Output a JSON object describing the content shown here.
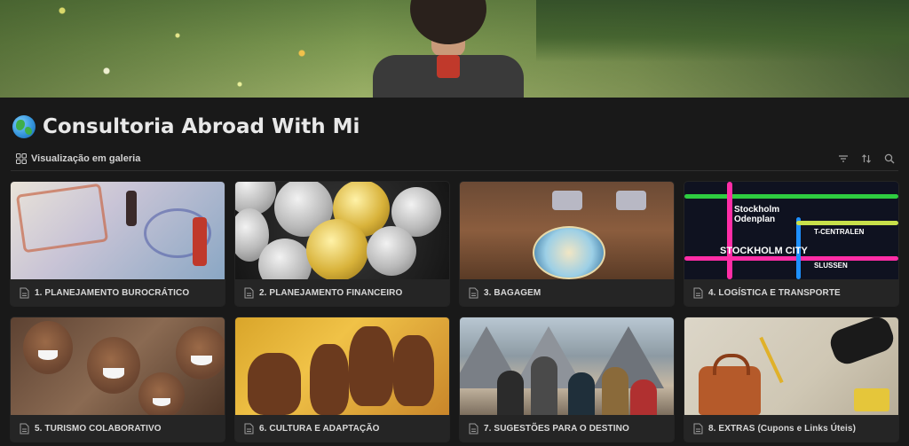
{
  "page": {
    "title": "Consultoria Abroad With Mi",
    "icon": "globe-icon"
  },
  "view": {
    "label": "Visualização em galeria",
    "icon": "gallery-grid-icon",
    "tools": [
      "filter-icon",
      "sort-icon",
      "search-icon"
    ]
  },
  "gallery": {
    "cards": [
      {
        "title": "1. PLANEJAMENTO BUROCRÁTICO"
      },
      {
        "title": "2. PLANEJAMENTO FINANCEIRO"
      },
      {
        "title": "3. BAGAGEM"
      },
      {
        "title": "4. LOGÍSTICA E TRANSPORTE"
      },
      {
        "title": "5. TURISMO COLABORATIVO"
      },
      {
        "title": "6. CULTURA E ADAPTAÇÃO"
      },
      {
        "title": "7. SUGESTÕES PARA O DESTINO"
      },
      {
        "title": "8. EXTRAS (Cupons e Links Úteis)"
      }
    ]
  },
  "thumbnails": {
    "metro_map": {
      "station_top": "Stockholm Odenplan",
      "city": "STOCKHOLM CITY",
      "line": "T-CENTRALEN",
      "station_bottom": "SLUSSEN"
    }
  }
}
